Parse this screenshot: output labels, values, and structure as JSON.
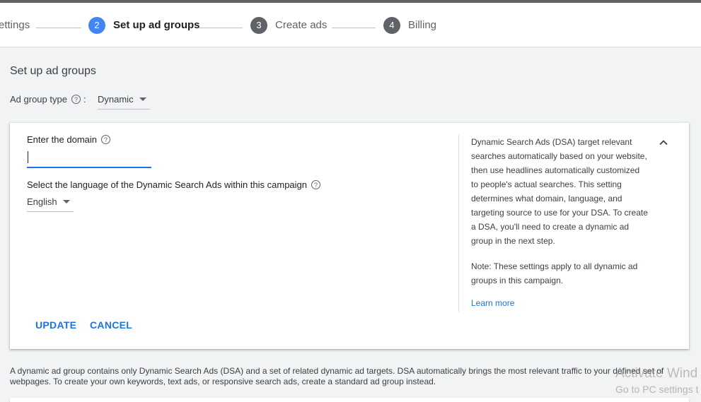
{
  "stepper": {
    "steps": [
      {
        "num": "",
        "label": "ettings"
      },
      {
        "num": "2",
        "label": "Set up ad groups"
      },
      {
        "num": "3",
        "label": "Create ads"
      },
      {
        "num": "4",
        "label": "Billing"
      }
    ],
    "active_step": "2"
  },
  "page": {
    "title": "Set up ad groups",
    "ad_group_type_label": "Ad group type",
    "ad_group_type_value": "Dynamic"
  },
  "card": {
    "domain_label": "Enter the domain",
    "domain_value": "",
    "language_label": "Select the language of the Dynamic Search Ads within this campaign",
    "language_value": "English",
    "description": "Dynamic Search Ads (DSA) target relevant searches automatically based on your website, then use headlines automatically customized to people's actual searches. This setting determines what domain, language, and targeting source to use for your DSA. To create a DSA, you'll need to create a dynamic ad group in the next step.",
    "note": "Note: These settings apply to all dynamic ad groups in this campaign.",
    "learn_more": "Learn more",
    "update_label": "UPDATE",
    "cancel_label": "CANCEL"
  },
  "footer": {
    "text": "A dynamic ad group contains only Dynamic Search Ads (DSA) and a set of related dynamic ad targets. DSA automatically brings the most relevant traffic to your defined set of webpages. To create your own keywords, text ads, or responsive search ads, create a standard ad group instead."
  },
  "watermark": {
    "line1": "Activate Wind",
    "line2": "Go to PC settings t"
  },
  "colors": {
    "accent": "#1a73e8",
    "active_step": "#4285f4",
    "inactive_step": "#5f6368"
  }
}
